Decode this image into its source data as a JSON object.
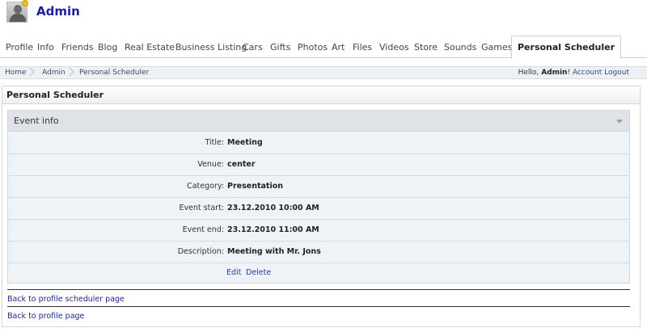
{
  "header": {
    "username": "Admin"
  },
  "tabs": [
    {
      "label": "Profile"
    },
    {
      "label": "Info"
    },
    {
      "label": "Friends"
    },
    {
      "label": "Blog"
    },
    {
      "label": "Real Estate"
    },
    {
      "label": "Business Listing"
    },
    {
      "label": "Cars"
    },
    {
      "label": "Gifts"
    },
    {
      "label": "Photos"
    },
    {
      "label": "Art"
    },
    {
      "label": "Files"
    },
    {
      "label": "Videos"
    },
    {
      "label": "Store"
    },
    {
      "label": "Sounds"
    },
    {
      "label": "Games"
    },
    {
      "label": "Personal Scheduler"
    }
  ],
  "breadcrumb": {
    "home": "Home",
    "admin": "Admin",
    "current": "Personal Scheduler"
  },
  "userbar": {
    "hello": "Hello,",
    "name": "Admin",
    "exclaim": "!",
    "account": "Account",
    "logout": "Logout"
  },
  "panel": {
    "title": "Personal Scheduler"
  },
  "event": {
    "heading": "Event info",
    "fields": [
      {
        "label": "Title:",
        "value": "Meeting"
      },
      {
        "label": "Venue:",
        "value": "center"
      },
      {
        "label": "Category:",
        "value": "Presentation"
      },
      {
        "label": "Event start:",
        "value": "23.12.2010 10:00 AM"
      },
      {
        "label": "Event end:",
        "value": "23.12.2010 11:00 AM"
      },
      {
        "label": "Description:",
        "value": "Meeting with Mr. Jons"
      }
    ],
    "edit": "Edit",
    "delete": "Delete"
  },
  "links": {
    "back_scheduler": "Back to profile scheduler page",
    "back_profile": "Back to profile page"
  }
}
